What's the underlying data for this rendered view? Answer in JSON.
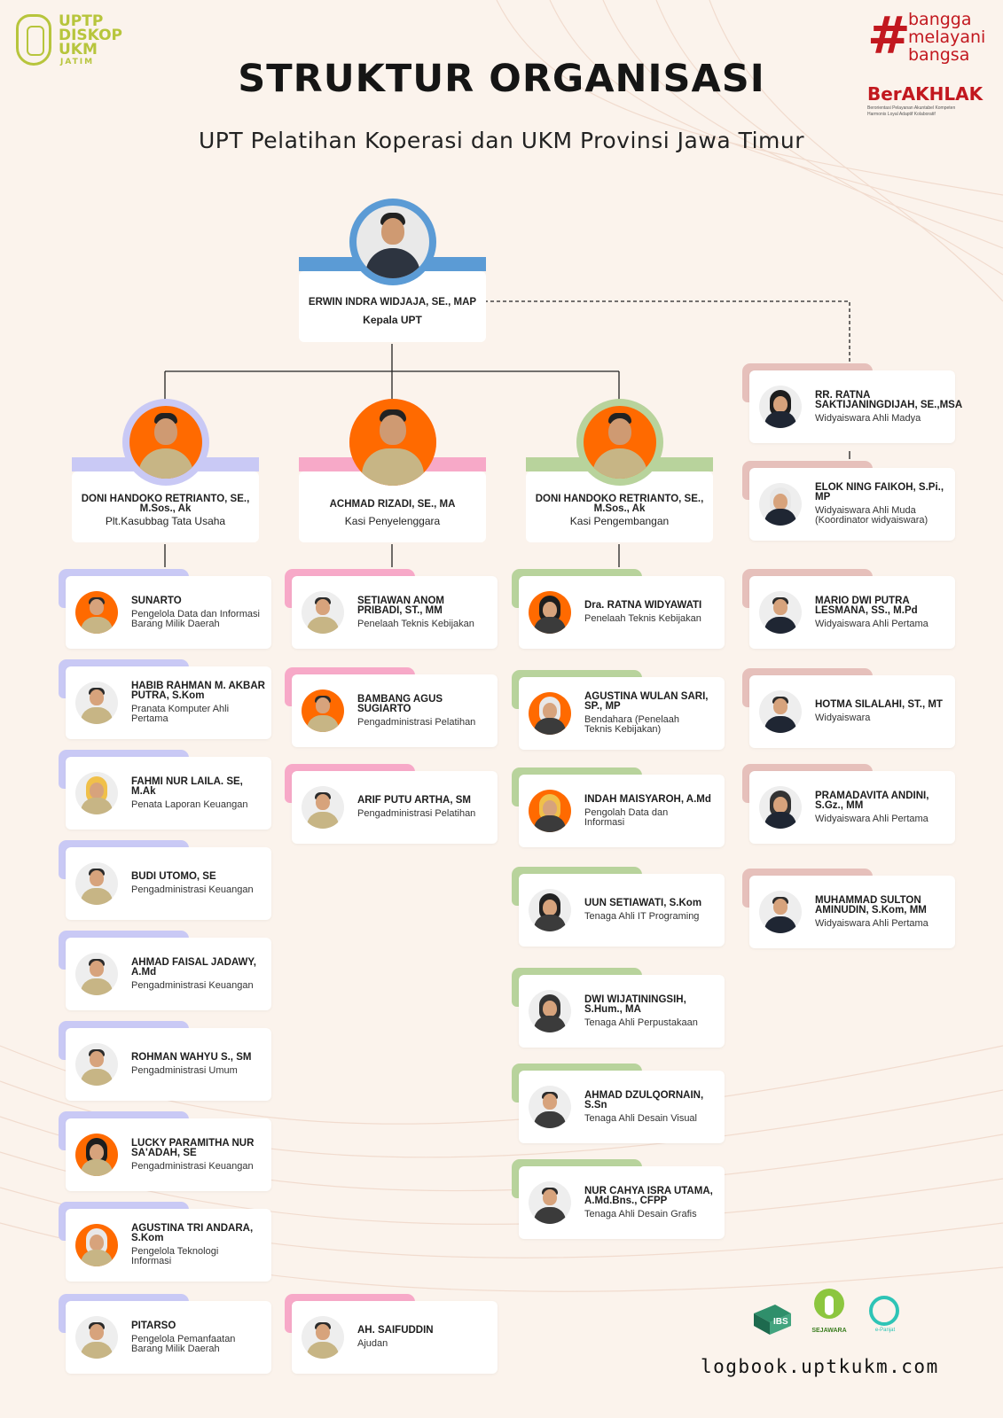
{
  "header": {
    "logo_left": [
      "UPTP",
      "DISKOP",
      "UKM",
      "JATIM"
    ],
    "title": "STRUKTUR ORGANISASI",
    "subtitle": "UPT Pelatihan Koperasi dan UKM Provinsi Jawa Timur",
    "slogan_hash": "#",
    "slogan": [
      "bangga",
      "melayani",
      "bangsa"
    ],
    "berakhlak": "BerAKHLAK",
    "berakhlak_tagline": [
      "Berorientasi Pelayanan Akuntabel Kompeten",
      "Harmonis Loyal Adaptif Kolaboratif"
    ]
  },
  "colors": {
    "background": "#fbf3ec",
    "top_bar": "#5b9bd5",
    "tu": "#c9c9f5",
    "penyelenggara": "#f7a9c8",
    "pengembangan": "#b8d39c",
    "widyaiswara": "#e6c0bb",
    "orange_ring": "#ff6a00"
  },
  "head": {
    "name": "ERWIN INDRA WIDJAJA, SE., MAP",
    "role": "Kepala UPT"
  },
  "divisions": [
    {
      "name": [
        "DONI HANDOKO RETRIANTO, SE.,",
        "M.Sos., Ak"
      ],
      "role": "Plt.Kasubbag Tata Usaha"
    },
    {
      "name": [
        "ACHMAD RIZADI, SE., MA"
      ],
      "role": "Kasi Penyelenggara"
    },
    {
      "name": [
        "DONI HANDOKO RETRIANTO, SE.,",
        "M.Sos., Ak"
      ],
      "role": "Kasi Pengembangan"
    }
  ],
  "tata_usaha": [
    {
      "name": [
        "SUNARTO"
      ],
      "role": [
        "Pengelola Data dan Informasi",
        "Barang Milik Daerah"
      ]
    },
    {
      "name": [
        "HABIB RAHMAN M. AKBAR",
        "PUTRA, S.Kom"
      ],
      "role": [
        "Pranata Komputer Ahli",
        "Pertama"
      ]
    },
    {
      "name": [
        "FAHMI NUR LAILA. SE,",
        "M.Ak"
      ],
      "role": [
        "Penata Laporan Keuangan"
      ]
    },
    {
      "name": [
        "BUDI UTOMO, SE"
      ],
      "role": [
        "Pengadministrasi Keuangan"
      ]
    },
    {
      "name": [
        "AHMAD FAISAL JADAWY,",
        "A.Md"
      ],
      "role": [
        "Pengadministrasi Keuangan"
      ]
    },
    {
      "name": [
        "ROHMAN WAHYU S., SM"
      ],
      "role": [
        "Pengadministrasi Umum"
      ]
    },
    {
      "name": [
        "LUCKY PARAMITHA NUR",
        "SA'ADAH, SE"
      ],
      "role": [
        "Pengadministrasi Keuangan"
      ]
    },
    {
      "name": [
        "AGUSTINA TRI ANDARA,",
        "S.Kom"
      ],
      "role": [
        "Pengelola Teknologi",
        "Informasi"
      ]
    },
    {
      "name": [
        "PITARSO"
      ],
      "role": [
        "Pengelola Pemanfaatan",
        "Barang Milik Daerah"
      ]
    }
  ],
  "penyelenggara": [
    {
      "name": [
        "SETIAWAN ANOM",
        "PRIBADI, ST., MM"
      ],
      "role": [
        "Penelaah Teknis Kebijakan"
      ]
    },
    {
      "name": [
        "BAMBANG AGUS",
        "SUGIARTO"
      ],
      "role": [
        "Pengadministrasi Pelatihan"
      ]
    },
    {
      "name": [
        "ARIF PUTU ARTHA, SM"
      ],
      "role": [
        "Pengadministrasi Pelatihan"
      ]
    },
    {
      "name": [
        "AH. SAIFUDDIN"
      ],
      "role": [
        "Ajudan"
      ]
    }
  ],
  "pengembangan": [
    {
      "name": [
        "Dra. RATNA WIDYAWATI"
      ],
      "role": [
        "Penelaah Teknis Kebijakan"
      ]
    },
    {
      "name": [
        "AGUSTINA WULAN SARI,",
        "SP., MP"
      ],
      "role": [
        "Bendahara (Penelaah",
        "Teknis Kebijakan)"
      ]
    },
    {
      "name": [
        "INDAH MAISYAROH, A.Md"
      ],
      "role": [
        "Pengolah Data dan",
        "Informasi"
      ]
    },
    {
      "name": [
        "UUN SETIAWATI, S.Kom"
      ],
      "role": [
        "Tenaga Ahli IT Programing"
      ]
    },
    {
      "name": [
        "DWI WIJATININGSIH,",
        "S.Hum., MA"
      ],
      "role": [
        "Tenaga Ahli Perpustakaan"
      ]
    },
    {
      "name": [
        "AHMAD DZULQORNAIN,",
        "S.Sn"
      ],
      "role": [
        "Tenaga Ahli Desain Visual"
      ]
    },
    {
      "name": [
        "NUR CAHYA ISRA UTAMA,",
        "A.Md.Bns., CFPP"
      ],
      "role": [
        "Tenaga Ahli Desain Grafis"
      ]
    }
  ],
  "widyaiswara": [
    {
      "name": [
        "RR. RATNA",
        "SAKTIJANINGDIJAH, SE.,MSA"
      ],
      "role": [
        "Widyaiswara Ahli Madya"
      ]
    },
    {
      "name": [
        "ELOK NING FAIKOH, S.Pi.,",
        "MP"
      ],
      "role": [
        "Widyaiswara Ahli Muda",
        "(Koordinator widyaiswara)"
      ]
    },
    {
      "name": [
        "MARIO DWI PUTRA",
        "LESMANA, SS., M.Pd"
      ],
      "role": [
        "Widyaiswara Ahli Pertama"
      ]
    },
    {
      "name": [
        "HOTMA SILALAHI, ST., MT"
      ],
      "role": [
        "Widyaiswara"
      ]
    },
    {
      "name": [
        "PRAMADAVITA ANDINI,",
        "S.Gz., MM"
      ],
      "role": [
        "Widyaiswara Ahli Pertama"
      ]
    },
    {
      "name": [
        "MUHAMMAD SULTON",
        "AMINUDIN, S.Kom, MM"
      ],
      "role": [
        "Widyaiswara Ahli Pertama"
      ]
    }
  ],
  "footer": {
    "logos": [
      "IBS",
      "SEJAWARA",
      "e-Panjat"
    ],
    "website": "logbook.uptkukm.com"
  }
}
